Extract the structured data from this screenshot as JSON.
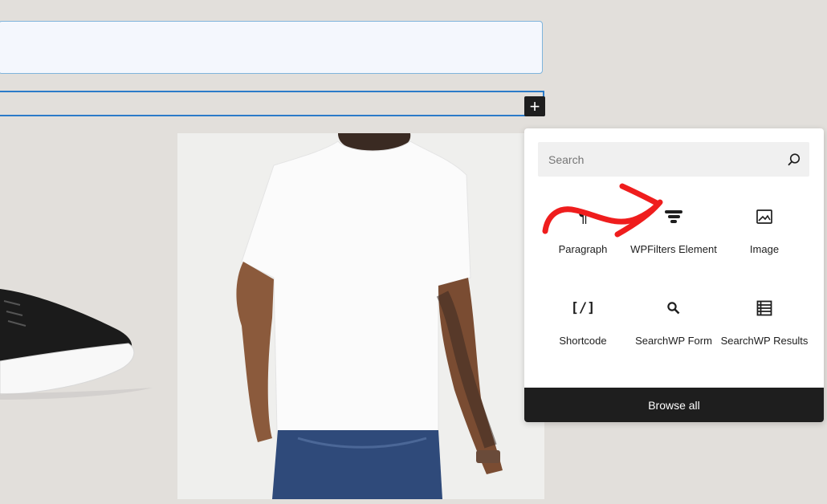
{
  "editor": {
    "inserter_symbol": "+"
  },
  "inserter": {
    "search_placeholder": "Search",
    "search_value": "",
    "browse_all_label": "Browse all",
    "blocks": [
      {
        "label": "Paragraph",
        "icon": "paragraph-icon"
      },
      {
        "label": "WPFilters Element",
        "icon": "wpfilters-icon"
      },
      {
        "label": "Image",
        "icon": "image-icon"
      },
      {
        "label": "Shortcode",
        "icon": "shortcode-icon"
      },
      {
        "label": "SearchWP Form",
        "icon": "search-icon"
      },
      {
        "label": "SearchWP Results",
        "icon": "list-icon"
      }
    ]
  },
  "colors": {
    "annotation_arrow": "#ef1d1d",
    "selection_outline": "#2c7bc9",
    "dark": "#1e1e1e"
  }
}
